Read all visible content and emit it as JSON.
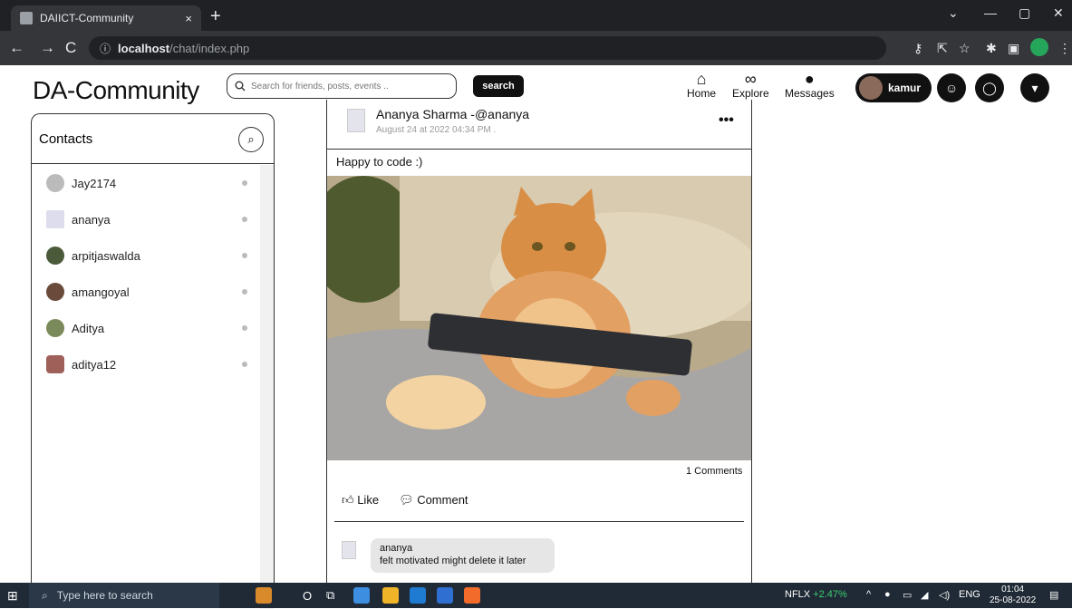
{
  "browser": {
    "tab_title": "DAIICT-Community",
    "tab_close": "×",
    "new_tab": "+",
    "url_host": "localhost",
    "url_path": "/chat/index.php",
    "controls": {
      "minimize": "—",
      "maximize": "▢",
      "close": "✕",
      "dropdown": "⌄"
    }
  },
  "app": {
    "logo": "DA-Community",
    "search_placeholder": "Search for friends, posts, events ..",
    "search_button": "search",
    "nav": {
      "home": "Home",
      "explore": "Explore",
      "messages": "Messages"
    },
    "user_name": "kamur"
  },
  "contacts": {
    "title": "Contacts",
    "items": [
      {
        "name": "Jay2174"
      },
      {
        "name": "ananya"
      },
      {
        "name": "arpitjaswalda"
      },
      {
        "name": "amangoyal"
      },
      {
        "name": "Aditya"
      },
      {
        "name": "aditya12"
      }
    ]
  },
  "post": {
    "author": "Ananya Sharma -@ananya",
    "date": "August 24 at 2022 04:34 PM .",
    "more": "•••",
    "text": "Happy to code :)",
    "comment_count": "1 Comments",
    "like_label": "Like",
    "comment_label": "Comment",
    "comments": [
      {
        "author": "ananya",
        "text": "felt motivated might delete it later"
      }
    ]
  },
  "taskbar": {
    "search_placeholder": "Type here to search",
    "stock_name": "NFLX",
    "stock_change": "+2.47%",
    "lang": "ENG",
    "time": "01:04",
    "date": "25-08-2022"
  },
  "colors": {
    "accent": "#111111",
    "panel_border": "#333333",
    "stock_up": "#3cd070"
  }
}
